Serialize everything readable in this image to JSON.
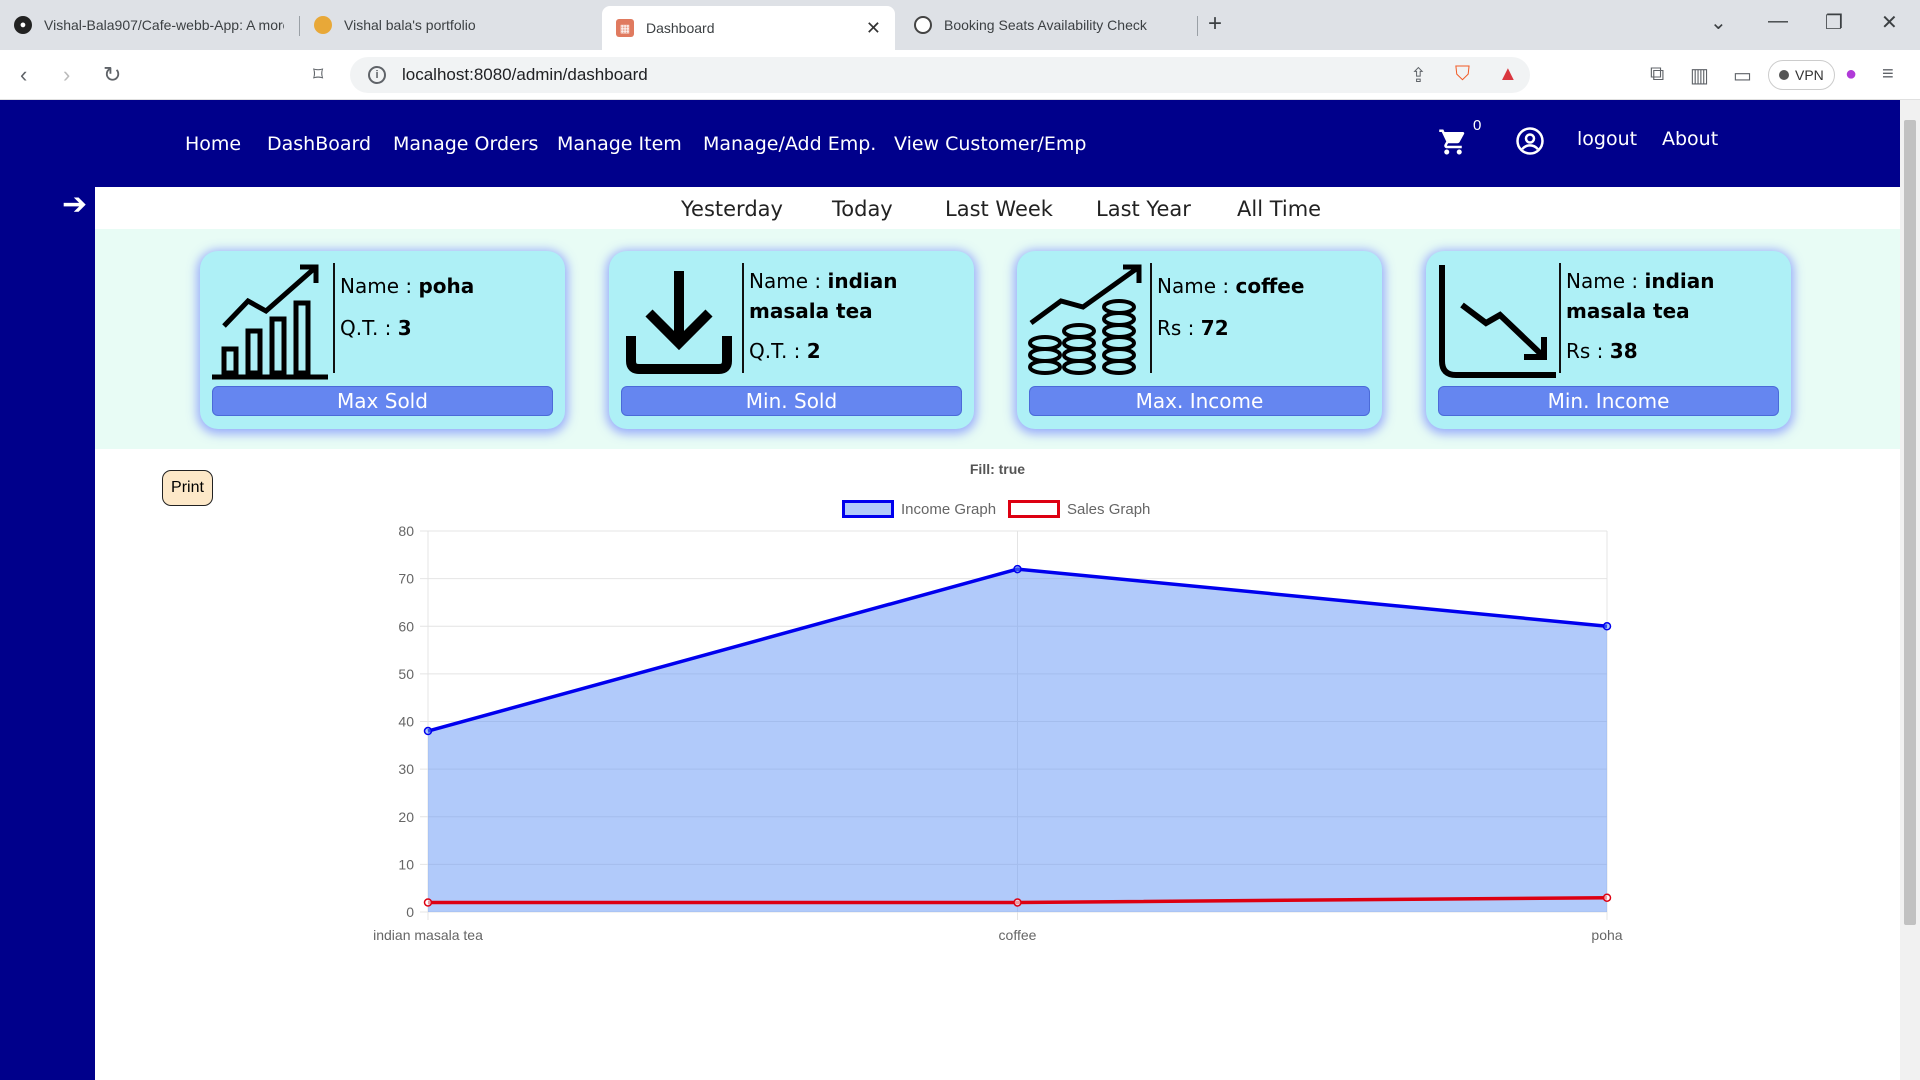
{
  "browser": {
    "tabs": [
      {
        "title": "Vishal-Bala907/Cafe-webb-App: A more",
        "icon": "github-icon"
      },
      {
        "title": "Vishal bala's portfolio",
        "icon": "avatar-icon"
      },
      {
        "title": "Dashboard",
        "icon": "store-icon"
      },
      {
        "title": "Booking Seats Availability Check",
        "icon": "openai-icon"
      }
    ],
    "url": "localhost:8080/admin/dashboard",
    "vpn_label": "VPN"
  },
  "nav": {
    "links": [
      "Home",
      "DashBoard",
      "Manage Orders",
      "Manage Item",
      "Manage/Add Emp.",
      "View Customer/Emp"
    ],
    "cart_count": "0",
    "logout": "logout",
    "about": "About"
  },
  "filters": [
    "Yesterday",
    "Today",
    "Last Week",
    "Last Year",
    "All Time"
  ],
  "cards": [
    {
      "name_label": "Name : ",
      "name": "poha",
      "metric_label": "Q.T. : ",
      "metric": "3",
      "label": "Max Sold",
      "icon": "growth-chart-icon"
    },
    {
      "name_label": "Name : ",
      "name": "indian masala tea",
      "metric_label": "Q.T. : ",
      "metric": "2",
      "label": "Min. Sold",
      "icon": "download-icon"
    },
    {
      "name_label": "Name : ",
      "name": "coffee",
      "metric_label": "Rs : ",
      "metric": "72",
      "label": "Max. Income",
      "icon": "coins-growth-icon"
    },
    {
      "name_label": "Name : ",
      "name": "indian masala tea",
      "metric_label": "Rs : ",
      "metric": "38",
      "label": "Min. Income",
      "icon": "decline-chart-icon"
    }
  ],
  "print_label": "Print",
  "chart_data": {
    "type": "area",
    "title": "Fill: true",
    "categories": [
      "indian masala tea",
      "coffee",
      "poha"
    ],
    "series": [
      {
        "name": "Income Graph",
        "values": [
          38,
          72,
          60
        ],
        "color": "#0000ee",
        "fill": "rgba(100,150,245,0.5)"
      },
      {
        "name": "Sales Graph",
        "values": [
          2,
          2,
          3
        ],
        "color": "#dd0011",
        "fill": "none"
      }
    ],
    "ylim": [
      0,
      80
    ],
    "yticks": [
      0,
      10,
      20,
      30,
      40,
      50,
      60,
      70,
      80
    ],
    "legend": "top",
    "grid": true
  }
}
